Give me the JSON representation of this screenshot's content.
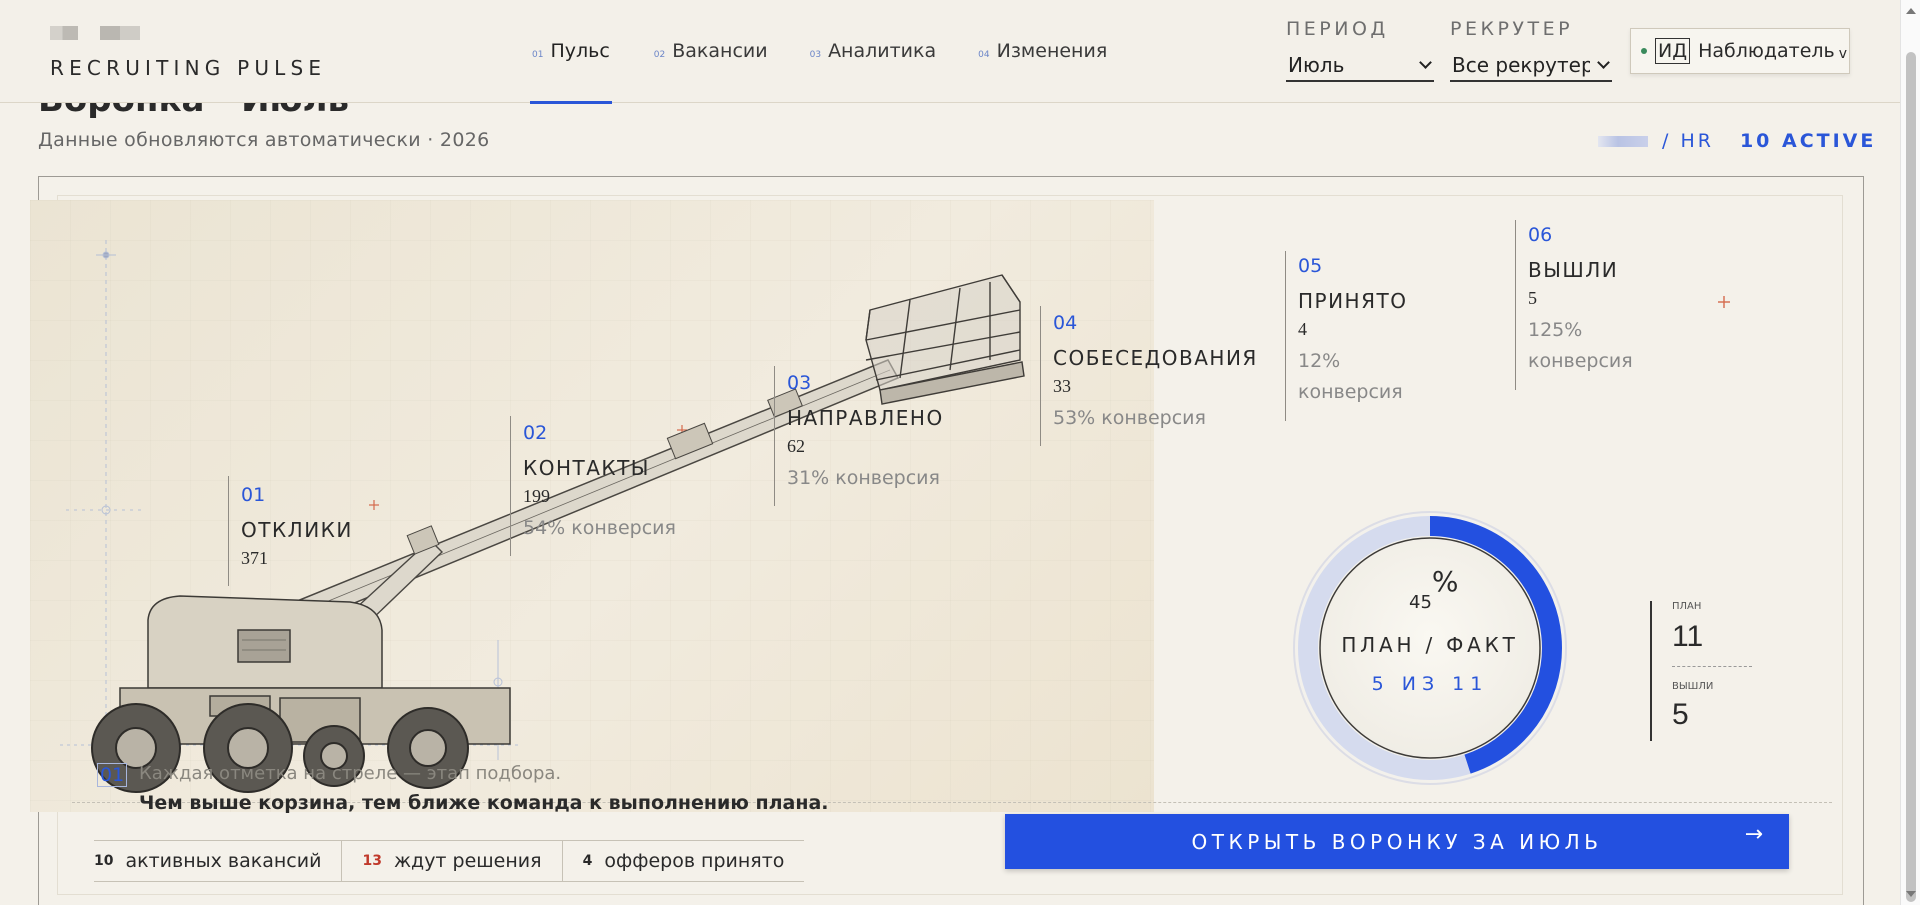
{
  "app": {
    "logo_text": "RECRUITING PULSE"
  },
  "nav": [
    {
      "num": "01",
      "label": "Пульс",
      "active": true
    },
    {
      "num": "02",
      "label": "Вакансии"
    },
    {
      "num": "03",
      "label": "Аналитика"
    },
    {
      "num": "04",
      "label": "Изменения"
    }
  ],
  "filters": {
    "period": {
      "label": "ПЕРИОД",
      "value": "Июль"
    },
    "recruiter": {
      "label": "РЕКРУТЕР",
      "value": "Все рекрутер"
    }
  },
  "user": {
    "initials": "ИД",
    "role": "Наблюдатель",
    "role_chevron": "v"
  },
  "page": {
    "title_peek": "Воронка · Июль",
    "subtitle": "Данные обновляются автоматически · 2026",
    "hr_label": "/ HR",
    "active_label": "10 ACTIVE"
  },
  "funnel": [
    {
      "num": "01",
      "name": "ОТКЛИКИ",
      "count": "371",
      "conversion": ""
    },
    {
      "num": "02",
      "name": "КОНТАКТЫ",
      "count": "199",
      "conversion": "54% конверсия"
    },
    {
      "num": "03",
      "name": "НАПРАВЛЕНО",
      "count": "62",
      "conversion": "31% конверсия"
    },
    {
      "num": "04",
      "name": "СОБЕСЕДОВАНИЯ",
      "count": "33",
      "conversion": "53% конверсия"
    },
    {
      "num": "05",
      "name": "ПРИНЯТО",
      "count": "4",
      "conversion_pct": "12%",
      "conversion_word": "конверсия"
    },
    {
      "num": "06",
      "name": "ВЫШЛИ",
      "count": "5",
      "conversion_pct": "125%",
      "conversion_word": "конверсия"
    }
  ],
  "caption": {
    "num": "01",
    "light": "Каждая отметка на стреле — этап подбора.",
    "bold": "Чем выше корзина, тем ближе команда к выполнению плана."
  },
  "stats": [
    {
      "n": "10",
      "label": "активных вакансий",
      "color": "#2a2a2a"
    },
    {
      "n": "13",
      "label": "ждут решения",
      "color": "#c0392b"
    },
    {
      "n": "4",
      "label": "офферов принято",
      "color": "#2a2a2a"
    }
  ],
  "gauge": {
    "percent": 45,
    "percent_text": "45",
    "percent_sign": "%",
    "title": "ПЛАН / ФАКТ",
    "subtitle": "5 ИЗ 11",
    "accent": "#2350e0"
  },
  "plan_box": {
    "plan_label": "ПЛАН",
    "plan_value": "11",
    "out_label": "ВЫШЛИ",
    "out_value": "5"
  },
  "cta": {
    "label": "ОТКРЫТЬ ВОРОНКУ ЗА ИЮЛЬ",
    "arrow": "→"
  },
  "colors": {
    "accent": "#2a56d8",
    "background": "#f4f1ea",
    "alert": "#c0392b"
  }
}
